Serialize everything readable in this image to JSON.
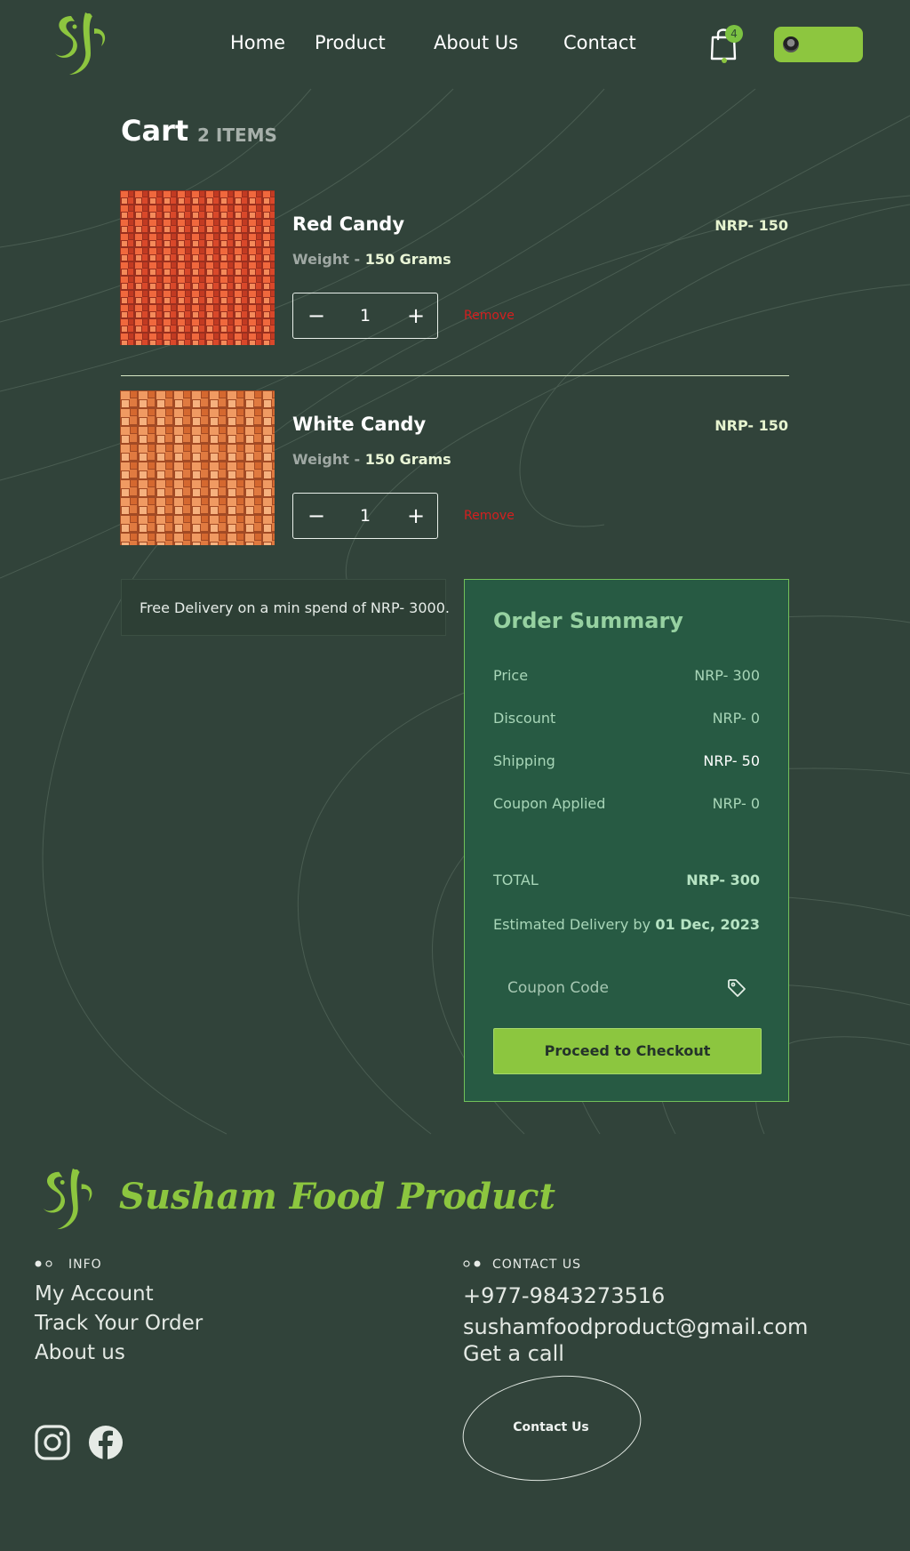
{
  "colors": {
    "background": "#31433a",
    "accent": "#8dc63f",
    "summary_bg": "#275a43",
    "remove": "#d41f1f"
  },
  "header": {
    "nav": [
      "Home",
      "Product",
      "About Us",
      "Contact"
    ],
    "cart_badge": "4",
    "icons": [
      "logo",
      "shopping-bag-icon",
      "avatar"
    ]
  },
  "cart": {
    "title": "Cart",
    "count_label": "2 ITEMS",
    "items": [
      {
        "name": "Red Candy",
        "weight_label": "Weight -",
        "weight": "150 Grams",
        "price": "NRP- 150",
        "quantity": "1",
        "remove_label": "Remove"
      },
      {
        "name": "White Candy",
        "weight_label": "Weight -",
        "weight": "150 Grams",
        "price": "NRP- 150",
        "quantity": "1",
        "remove_label": "Remove"
      }
    ],
    "free_delivery": "Free Delivery on a min spend of NRP- 3000."
  },
  "summary": {
    "title": "Order Summary",
    "price_label": "Price",
    "price": "NRP- 300",
    "discount_label": "Discount",
    "discount": "NRP- 0",
    "shipping_label": "Shipping",
    "shipping": "NRP- 50",
    "coupon_label": "Coupon Applied",
    "coupon": "NRP- 0",
    "total_label": "TOTAL",
    "total": "NRP- 300",
    "delivery_label": "Estimated Delivery by",
    "delivery_date": "01 Dec, 2023",
    "coupon_placeholder": "Coupon Code",
    "checkout_label": "Proceed to Checkout"
  },
  "footer": {
    "brand": "Susham Food Product",
    "info_title": "INFO",
    "info_links": [
      "My Account",
      "Track Your Order",
      "About us"
    ],
    "contact_title": "CONTACT US",
    "phone": "+977-9843273516",
    "email": "sushamfoodproduct@gmail.com",
    "get_call": "Get a call",
    "contact_button": "Contact Us"
  }
}
